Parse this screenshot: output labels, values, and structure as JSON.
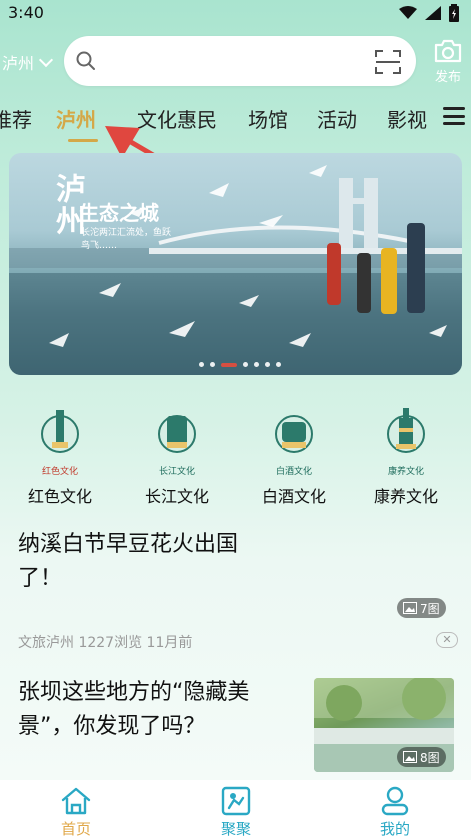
{
  "status": {
    "time": "3:40"
  },
  "header": {
    "city": "泸州",
    "search_placeholder": "",
    "publish_label": "发布"
  },
  "tabs": [
    {
      "label": "推荐"
    },
    {
      "label": "泸州"
    },
    {
      "label": "文化惠民"
    },
    {
      "label": "场馆"
    },
    {
      "label": "活动"
    },
    {
      "label": "影视"
    }
  ],
  "banner": {
    "title": "泸州",
    "subtitle": "生态之城",
    "desc": "长沱两江汇流处，鱼跃鸟飞……",
    "slide_count": 7,
    "active_slide": 3
  },
  "categories": [
    {
      "small": "红色文化",
      "label": "红色文化",
      "color": "#c0392b"
    },
    {
      "small": "长江文化",
      "label": "长江文化",
      "color": "#2c7a6b"
    },
    {
      "small": "白酒文化",
      "label": "白酒文化",
      "color": "#2c7a6b"
    },
    {
      "small": "康养文化",
      "label": "康养文化",
      "color": "#2c7a6b"
    }
  ],
  "articles": [
    {
      "title": "纳溪白节早豆花火出国了！",
      "image_count": "7图",
      "source": "文旅泸州",
      "views": "1227浏览",
      "time": "11月前"
    },
    {
      "title": "张坝这些地方的“隐藏美景”，你发现了吗？",
      "image_count": "8图"
    }
  ],
  "bottom_nav": [
    {
      "label": "首页",
      "icon": "home-icon",
      "active": true
    },
    {
      "label": "聚聚",
      "icon": "gather-icon",
      "active": false
    },
    {
      "label": "我的",
      "icon": "profile-icon",
      "active": false
    }
  ],
  "colors": {
    "accent": "#d4a848",
    "nav_active": "#e0a84a",
    "nav_inactive": "#2aa8c4",
    "arrow": "#e0473f"
  }
}
